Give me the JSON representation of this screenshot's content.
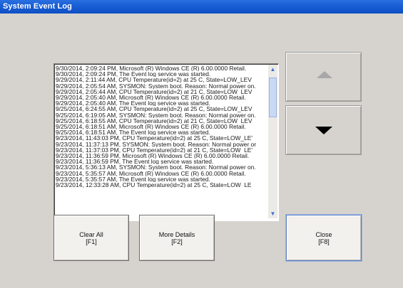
{
  "window": {
    "title": "System Event Log"
  },
  "log": {
    "lines": [
      "9/30/2014, 2:09:24 PM, Microsoft (R) Windows CE (R) 6.00.0000 Retail.",
      "9/30/2014, 2:09:24 PM, The Event log service was started.",
      "9/29/2014, 2:11:44 AM, CPU Temperature(id=2) at 25 C, State=LOW_LEV",
      "9/29/2014, 2:05:54 AM, SYSMON: System boot. Reason: Normal power on.",
      "9/29/2014, 2:05:44 AM, CPU Temperature(id=2) at 21 C, State=LOW_LEV",
      "9/29/2014, 2:05:40 AM, Microsoft (R) Windows CE (R) 6.00.0000 Retail.",
      "9/29/2014, 2:05:40 AM, The Event log service was started.",
      "9/25/2014, 6:24:55 AM, CPU Temperature(id=2) at 25 C, State=LOW_LEV",
      "9/25/2014, 6:19:05 AM, SYSMON: System boot. Reason: Normal power on.",
      "9/25/2014, 6:18:55 AM, CPU Temperature(id=2) at 21 C, State=LOW_LEV",
      "9/25/2014, 6:18:51 AM, Microsoft (R) Windows CE (R) 6.00.0000 Retail.",
      "9/25/2014, 6:18:51 AM, The Event log service was started.",
      "9/23/2014, 11:43:03 PM, CPU Temperature(id=2) at 25 C, State=LOW_LE'",
      "9/23/2014, 11:37:13 PM, SYSMON: System boot. Reason: Normal power or",
      "9/23/2014, 11:37:03 PM, CPU Temperature(id=2) at 21 C, State=LOW_LE'",
      "9/23/2014, 11:36:59 PM, Microsoft (R) Windows CE (R) 6.00.0000 Retail.",
      "9/23/2014, 11:36:59 PM, The Event log service was started.",
      "9/23/2014, 5:36:13 AM, SYSMON: System boot. Reason: Normal power on.",
      "9/23/2014, 5:35:57 AM, Microsoft (R) Windows CE (R) 6.00.0000 Retail.",
      "9/23/2014, 5:35:57 AM, The Event log service was started.",
      "9/23/2014, 12:33:28 AM, CPU Temperature(id=2) at 25 C, State=LOW_LE"
    ],
    "scroll_up_glyph": "▲",
    "scroll_down_glyph": "▼"
  },
  "buttons": {
    "clear_all": {
      "label": "Clear All",
      "key": "[F1]"
    },
    "more_details": {
      "label": "More Details",
      "key": "[F2]"
    },
    "close": {
      "label": "Close",
      "key": "[F8]"
    }
  },
  "icons": {
    "scroll_up": "arrow-up-icon",
    "scroll_down": "arrow-down-icon"
  },
  "colors": {
    "titlebar": "#0e4fc4",
    "background": "#d6d3ce",
    "log_bg": "#ffffff"
  }
}
